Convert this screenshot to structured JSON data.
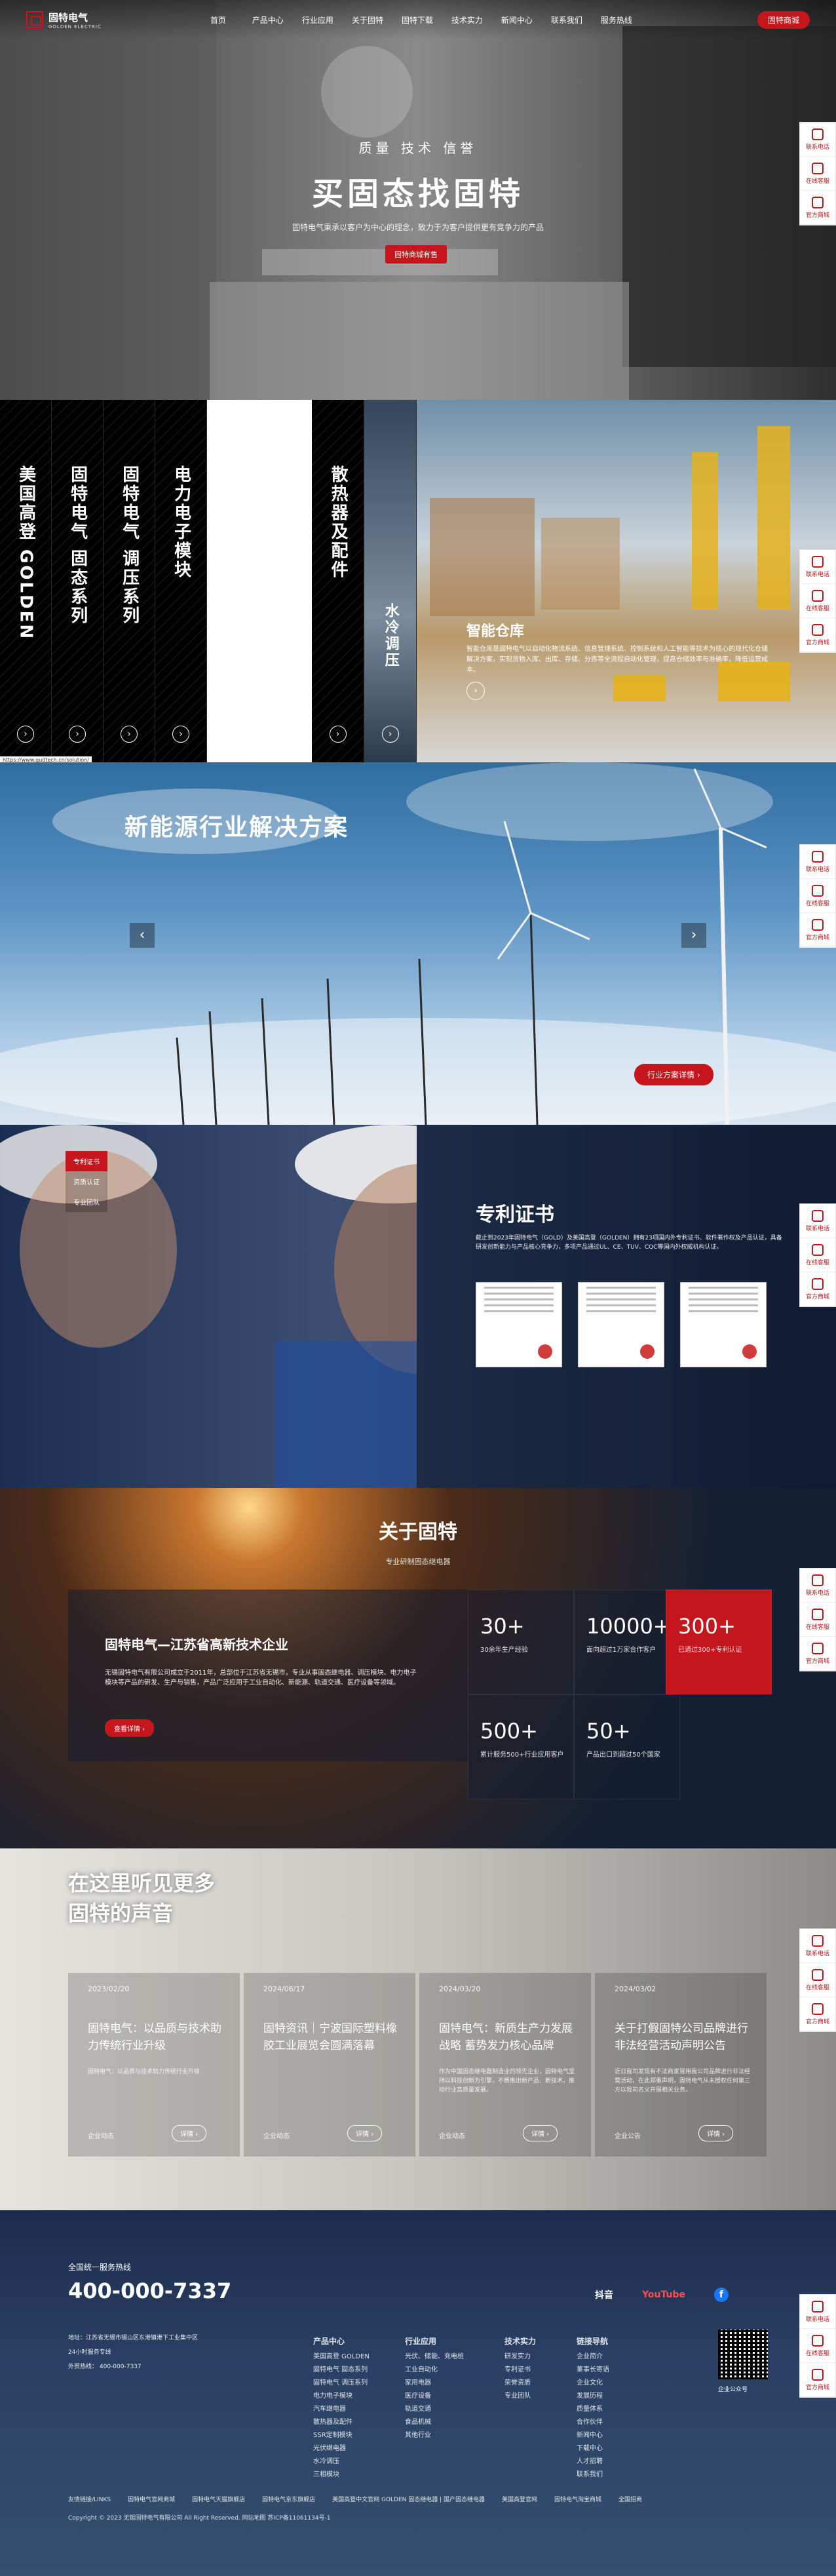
{
  "nav": {
    "brand_cn": "固特电气",
    "brand_en": "GOLDEN ELECTRIC",
    "items": [
      "首页",
      "产品中心",
      "行业应用",
      "关于固特",
      "固特下载",
      "技术实力",
      "新闻中心",
      "联系我们",
      "服务热线"
    ],
    "shop_label": "固特商城"
  },
  "hero": {
    "slogan": "质量 技术 信誉",
    "title": "买固态找固特",
    "desc": "固特电气秉承以客户为中心的理念，致力于为客户提供更有竞争力的产品",
    "button": "固特商城有售"
  },
  "side_float": {
    "items": [
      "联系电话",
      "在线客服",
      "官方商城"
    ]
  },
  "products": {
    "columns": [
      "美国高登 GOLDEN",
      "固特电气 固态系列",
      "固特电气 调压系列",
      "电力电子模块",
      "散热器及配件",
      "水冷调压"
    ],
    "arrow": "›",
    "warehouse_title": "智能仓库",
    "warehouse_desc": "智能仓库是固特电气以自动化物流系统、信息管理系统、控制系统和人工智能等技术为核心的现代化仓储解决方案，实现货物入库、出库、存储、分拣等全流程自动化管理，提高仓储效率与准确率，降低运营成本。",
    "status_url": "https://www.gudtech.cn/solution/"
  },
  "energy": {
    "title": "新能源行业解决方案",
    "prev": "‹",
    "next": "›",
    "button": "行业方案详情 ›"
  },
  "patent": {
    "tabs": [
      "专利证书",
      "资质认证",
      "专业团队"
    ],
    "title": "专利证书",
    "desc": "截止到2023年固特电气（GOLD）及美国高登（GOLDEN）拥有23项国内外专利证书、软件著作权及产品认证，具备研发创新能力与产品核心竞争力，多项产品通过UL、CE、TUV、CQC等国内外权威机构认证。"
  },
  "about": {
    "title": "关于固特",
    "subtitle": "专业研制固态继电器",
    "card_title": "固特电气—江苏省高新技术企业",
    "card_desc": "无锡固特电气有限公司成立于2011年，总部位于江苏省无锡市，专业从事固态继电器、调压模块、电力电子模块等产品的研发、生产与销售，产品广泛应用于工业自动化、新能源、轨道交通、医疗设备等领域。",
    "more": "查看详情 ›",
    "stats": [
      {
        "num": "30+",
        "label": "30余年生产经验"
      },
      {
        "num": "10000+",
        "label": "面向超过1万家合作客户"
      },
      {
        "num": "300+",
        "label": "已通过300+专利认证"
      },
      {
        "num": "500+",
        "label": "累计服务500+行业应用客户"
      },
      {
        "num": "50+",
        "label": "产品出口到超过50个国家"
      }
    ]
  },
  "news": {
    "title_line1": "在这里听见更多",
    "title_line2": "固特的声音",
    "items": [
      {
        "date": "2023/02/20",
        "title": "固特电气：以品质与技术助力传统行业升级",
        "excerpt": "固特电气：以品质与技术助力传统行业升级",
        "source": "企业动态",
        "more": "详情 ›"
      },
      {
        "date": "2024/06/17",
        "title": "固特资讯｜宁波国际塑料橡胶工业展览会圆满落幕",
        "excerpt": "",
        "source": "企业动态",
        "more": "详情 ›"
      },
      {
        "date": "2024/03/20",
        "title": "固特电气：新质生产力发展战略 蓄势发力核心品牌",
        "excerpt": "作为中国固态继电器制造业的领先企业，固特电气坚持以科技创新为引擎，不断推出新产品、新技术，推动行业高质量发展。",
        "source": "企业动态",
        "more": "详情 ›"
      },
      {
        "date": "2024/03/02",
        "title": "关于打假固特公司品牌进行非法经营活动声明公告",
        "excerpt": "近日我司发现有不法商家冒用我公司品牌进行非法经营活动，在此郑重声明，固特电气从未授权任何第三方以我司名义开展相关业务。",
        "source": "企业公告",
        "more": "详情 ›"
      }
    ]
  },
  "footer": {
    "hotline_label": "全国统一服务热线",
    "phone": "400-000-7337",
    "address_lines": [
      "地址：江苏省无锡市锡山区东港镇港下工业集中区",
      "24小时服务专线",
      "外贸热线： 400-000-7337"
    ],
    "cols": [
      {
        "head": "产品中心",
        "items": [
          "美国高登 GOLDEN",
          "固特电气 固态系列",
          "固特电气 调压系列",
          "电力电子模块",
          "汽车继电器",
          "散热器及配件",
          "SSR定制模块",
          "光伏继电器",
          "水冷调压",
          "三相模块"
        ]
      },
      {
        "head": "行业应用",
        "items": [
          "光伏、储能、充电桩",
          "工业自动化",
          "家用电器",
          "医疗设备",
          "轨道交通",
          "食品机械",
          "其他行业"
        ]
      },
      {
        "head": "技术实力",
        "items": [
          "研发实力",
          "专利证书",
          "荣誉资质",
          "专业团队"
        ]
      },
      {
        "head": "链接导航",
        "items": [
          "企业简介",
          "董事长寄语",
          "企业文化",
          "发展历程",
          "质量体系",
          "合作伙伴",
          "新闻中心",
          "下载中心",
          "人才招聘",
          "联系我们"
        ]
      }
    ],
    "social": [
      "抖音",
      "YouTube",
      "f"
    ],
    "qr_label": "企业公众号",
    "bottom_links": [
      "友情链接/LINKS",
      "固特电气官网商城",
      "固特电气天猫旗舰店",
      "固特电气京东旗舰店",
      "美国高登中文官网 GOLDEN 固态继电器 | 国产固态继电器",
      "美国高登官网",
      "固特电气淘宝商城",
      "全国招商"
    ],
    "copyright": "Copyright © 2023 无锡固特电气有限公司 All Right Reserved.  网站地图  苏ICP备11061134号-1"
  }
}
